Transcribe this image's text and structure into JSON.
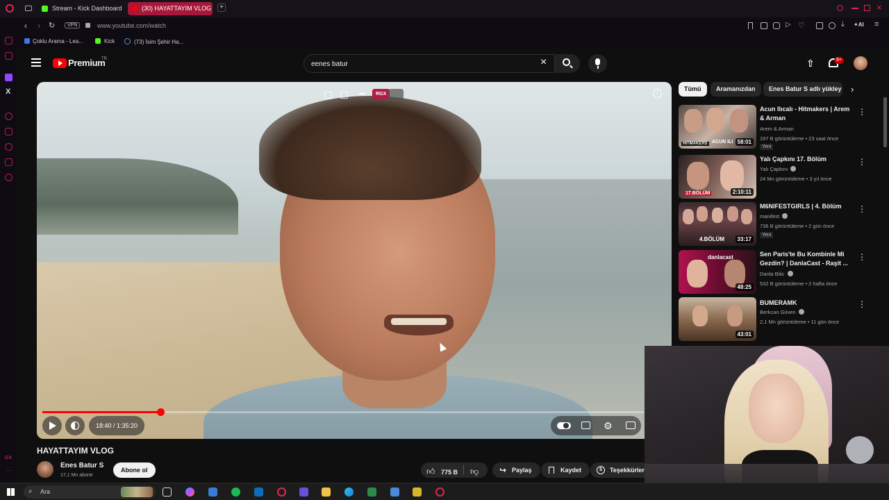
{
  "browser": {
    "tabs": [
      {
        "label": "Stream - Kick Dashboard",
        "active": false
      },
      {
        "label": "(30) HAYATTAYIM VLOG -",
        "active": true
      }
    ],
    "url": "www.youtube.com/watch",
    "vpn_label": "VPN",
    "ai_label": "AI",
    "bookmarks": [
      "Çoklu Arama - Lea...",
      "Kick",
      "(73) İsim Şehir Ha..."
    ]
  },
  "youtube": {
    "logo": "Premium",
    "region": "TR",
    "search_value": "eenes batur",
    "notif_count": "9+"
  },
  "player": {
    "time": "18:40 / 1:35:20",
    "progress": 0.196,
    "overlay_badge": "RGX"
  },
  "video": {
    "title": "HAYATTAYIM VLOG",
    "channel": "Enes Batur S",
    "subscribers": "17,1 Mn abone",
    "subscribe_label": "Abone ol",
    "likes": "775 B",
    "share_label": "Paylaş",
    "save_label": "Kaydet",
    "thanks_label": "Teşekkürler"
  },
  "chips": [
    "Tümü",
    "Aramanızdan",
    "Enes Batur S adlı yükley"
  ],
  "recommendations": [
    {
      "title": "Acun Ilıcalı - Hitmakers | Arem & Arman",
      "channel": "Arem & Arman",
      "meta": "197 B görüntüleme • 23 saat önce",
      "badge": "Yeni",
      "duration": "58:01",
      "thumb_text": "ACUN ILICALI",
      "thumb_tag": "HITMAKERS"
    },
    {
      "title": "Yalı Çapkını 17. Bölüm",
      "channel": "Yalı Çapkını",
      "meta": "24 Mn görüntüleme • 3 yıl önce",
      "badge": "",
      "duration": "2:10:11",
      "thumb_text": "17.BÖLÜM",
      "thumb_tag": ""
    },
    {
      "title": "M6NIFESTGIRLS | 4. Bölüm",
      "channel": "manifest",
      "meta": "736 B görüntüleme • 2 gün önce",
      "badge": "Yeni",
      "duration": "33:17",
      "thumb_text": "4.BÖLÜM",
      "thumb_tag": ""
    },
    {
      "title": "Sen Paris'te Bu Kombinle Mi Gezdin? | DanlaCast - Raşit ...",
      "channel": "Danla Bilic",
      "meta": "532 B görüntüleme • 2 hafta önce",
      "badge": "",
      "duration": "48:25",
      "thumb_text": "danlacast",
      "thumb_tag": ""
    },
    {
      "title": "BUMERAMK",
      "channel": "Berkcan Güven",
      "meta": "2,1 Mn görüntüleme • 11 gün önce",
      "badge": "",
      "duration": "43:01",
      "thumb_text": "",
      "thumb_tag": ""
    }
  ],
  "taskbar": {
    "search_label": "Ara"
  }
}
